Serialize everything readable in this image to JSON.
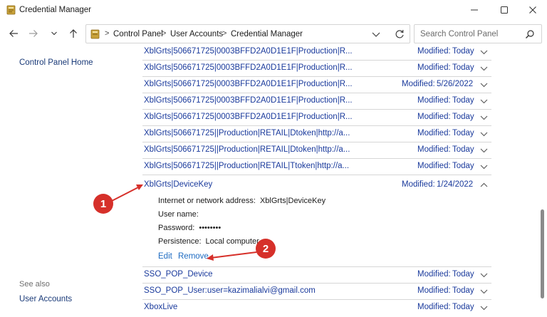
{
  "window": {
    "title": "Credential Manager",
    "icon": "credential-manager-icon"
  },
  "address_bar": {
    "breadcrumbs": [
      "Control Panel",
      "User Accounts",
      "Credential Manager"
    ],
    "separator": ">",
    "search_placeholder": "Search Control Panel"
  },
  "left_pane": {
    "home_link": "Control Panel Home",
    "see_also_label": "See also",
    "see_also_links": [
      "User Accounts"
    ]
  },
  "credentials": {
    "modified_label": "Modified:",
    "rows_above": [
      {
        "name": "XblGrts|506671725|0003BFFD2A0D1E1F|Production|R...",
        "date": "Today"
      },
      {
        "name": "XblGrts|506671725|0003BFFD2A0D1E1F|Production|R...",
        "date": "Today"
      },
      {
        "name": "XblGrts|506671725|0003BFFD2A0D1E1F|Production|R...",
        "date": "5/26/2022"
      },
      {
        "name": "XblGrts|506671725|0003BFFD2A0D1E1F|Production|R...",
        "date": "Today"
      },
      {
        "name": "XblGrts|506671725|0003BFFD2A0D1E1F|Production|R...",
        "date": "Today"
      },
      {
        "name": "XblGrts|506671725||Production|RETAIL|Dtoken|http://a...",
        "date": "Today"
      },
      {
        "name": "XblGrts|506671725||Production|RETAIL|Dtoken|http://a...",
        "date": "Today"
      },
      {
        "name": "XblGrts|506671725||Production|RETAIL|Ttoken|http://a...",
        "date": "Today"
      }
    ],
    "expanded": {
      "name": "XblGrts|DeviceKey",
      "date": "1/24/2022",
      "address_label": "Internet or network address:",
      "address_value": "XblGrts|DeviceKey",
      "username_label": "User name:",
      "username_value": "",
      "password_label": "Password:",
      "password_value": "••••••••",
      "persistence_label": "Persistence:",
      "persistence_value": "Local computer",
      "edit_label": "Edit",
      "remove_label": "Remove"
    },
    "rows_below": [
      {
        "name": "SSO_POP_Device",
        "date": "Today"
      },
      {
        "name": "SSO_POP_User:user=kazimalialvi@gmail.com",
        "date": "Today"
      },
      {
        "name": "XboxLive",
        "date": "Today"
      }
    ]
  },
  "annotations": {
    "badge_1": "1",
    "badge_2": "2",
    "color": "#d6302a"
  },
  "colors": {
    "link": "#1a3a9c",
    "action_link": "#1f6cc2",
    "divider": "#d6d6d6"
  }
}
